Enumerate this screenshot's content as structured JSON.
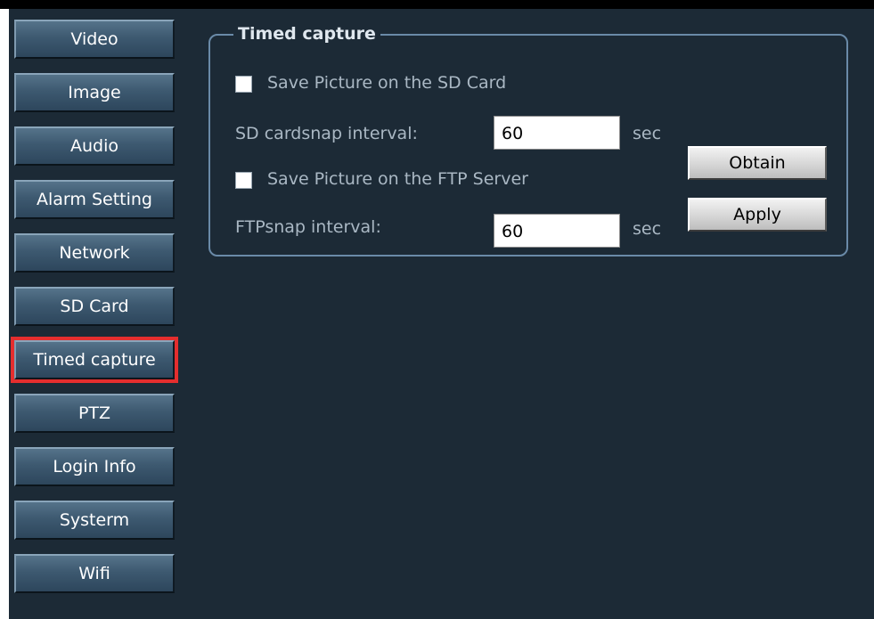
{
  "sidebar": {
    "items": [
      {
        "label": "Video"
      },
      {
        "label": "Image"
      },
      {
        "label": "Audio"
      },
      {
        "label": "Alarm Setting"
      },
      {
        "label": "Network"
      },
      {
        "label": "SD Card"
      },
      {
        "label": "Timed capture",
        "active": true
      },
      {
        "label": "PTZ"
      },
      {
        "label": "Login Info"
      },
      {
        "label": "Systerm"
      },
      {
        "label": "Wifi"
      }
    ]
  },
  "panel": {
    "title": "Timed capture",
    "sd_checkbox_label": "Save Picture on the SD Card",
    "sd_checked": false,
    "sd_interval_label": "SD cardsnap interval:",
    "sd_interval_value": "60",
    "sd_interval_unit": "sec",
    "ftp_checkbox_label": "Save Picture on the FTP Server",
    "ftp_checked": false,
    "ftp_interval_label": "FTPsnap interval:",
    "ftp_interval_value": "60",
    "ftp_interval_unit": "sec",
    "obtain_label": "Obtain",
    "apply_label": "Apply"
  },
  "colors": {
    "background": "#1c2a36",
    "active_outline": "#e52e2e",
    "group_border": "#6a8aa8"
  }
}
